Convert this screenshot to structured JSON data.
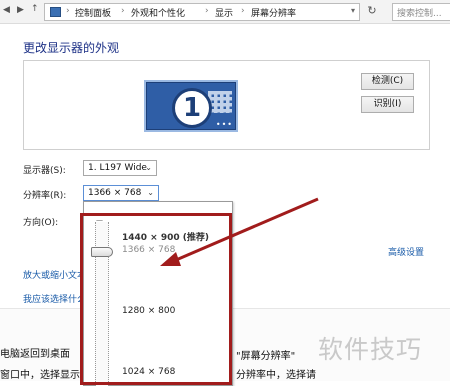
{
  "toolbar": {
    "back_icon": "back-arrow",
    "forward_icon": "forward-arrow",
    "up_icon": "up-arrow",
    "breadcrumbs": [
      "控制面板",
      "外观和个性化",
      "显示",
      "屏幕分辨率"
    ],
    "refresh_icon": "refresh",
    "search_placeholder": "搜索控制..."
  },
  "page": {
    "title": "更改显示器的外观",
    "monitor_number": "1",
    "detect_label": "检测(C)",
    "identify_label": "识别(I)"
  },
  "settings": {
    "display_label": "显示器(S):",
    "display_value": "1. L197 Wide",
    "resolution_label": "分辨率(R):",
    "resolution_value": "1366 × 768",
    "orientation_label": "方向(O):",
    "advanced_link": "高级设置",
    "resize_link": "放大或缩小文本",
    "choose_link": "我应该选择什么"
  },
  "resolution_dropdown": {
    "options": [
      "1440 × 900 (推荐)",
      "1366 × 768",
      "1280 × 800",
      "1024 × 768"
    ],
    "selected": "1366 × 768"
  },
  "article": {
    "line1": "电脑返回到桌面",
    "line1_right": "\"屏幕分辨率\"",
    "line2": "窗口中，选择显示器",
    "line2_right": "分辨率中，选择请"
  },
  "watermark": "软件技巧",
  "colors": {
    "highlight": "#a11c1c",
    "link": "#1a5ba8",
    "title": "#1e3287",
    "monitor": "#2f5ea6"
  }
}
